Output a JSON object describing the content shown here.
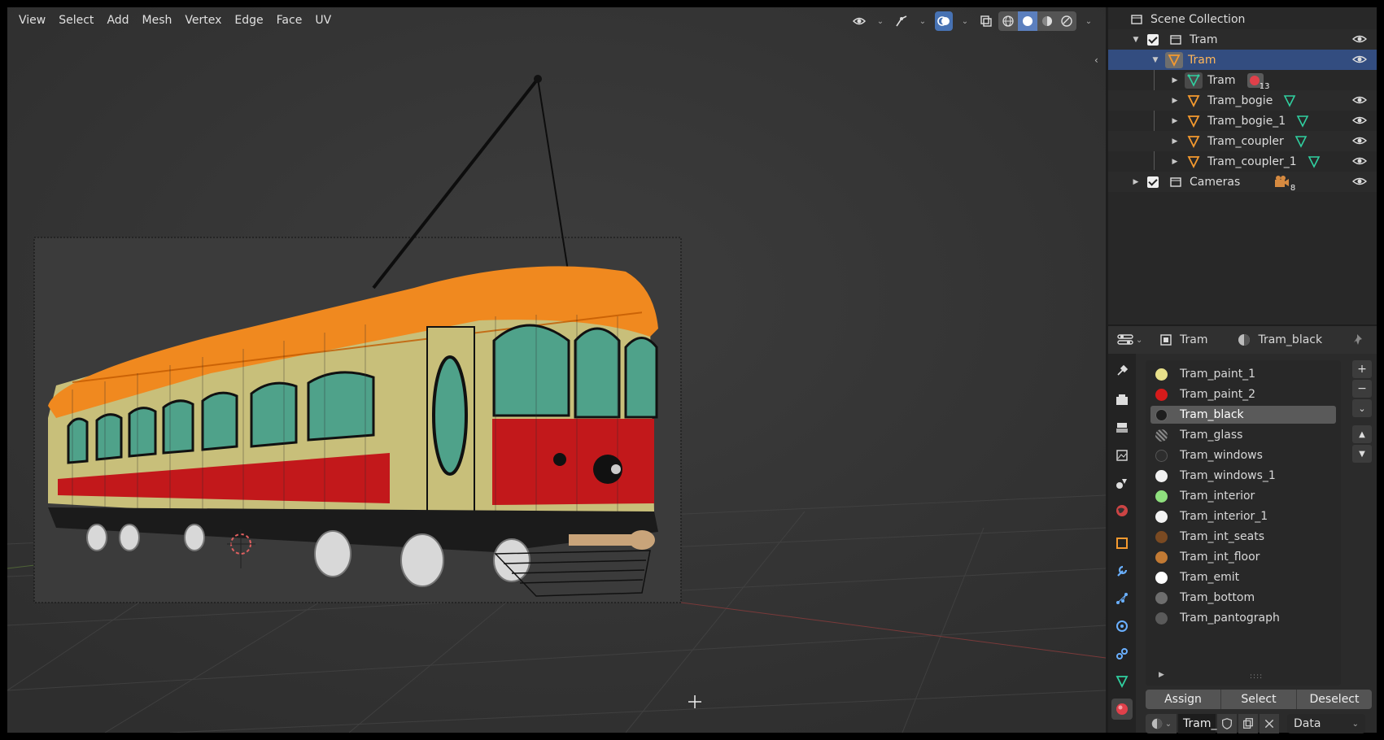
{
  "viewport": {
    "menu": [
      "View",
      "Select",
      "Add",
      "Mesh",
      "Vertex",
      "Edge",
      "Face",
      "UV"
    ]
  },
  "outliner": {
    "rows": [
      {
        "label": "Scene Collection",
        "icon": "scene-collection-icon"
      },
      {
        "label": "Tram",
        "icon": "collection-icon"
      },
      {
        "label": "Tram",
        "icon": "mesh-object-icon"
      },
      {
        "label": "Tram",
        "icon": "mesh-data-icon",
        "badge": "13",
        "badge_icon": "material-icon"
      },
      {
        "label": "Tram_bogie",
        "icon": "mesh-object-icon"
      },
      {
        "label": "Tram_bogie_1",
        "icon": "mesh-object-icon"
      },
      {
        "label": "Tram_coupler",
        "icon": "mesh-object-icon"
      },
      {
        "label": "Tram_coupler_1",
        "icon": "mesh-object-icon"
      },
      {
        "label": "Cameras",
        "icon": "collection-icon",
        "badge": "8",
        "badge_icon": "camera-icon"
      }
    ]
  },
  "properties": {
    "object_name": "Tram",
    "material_name": "Tram_black",
    "materials": [
      {
        "name": "Tram_paint_1",
        "color": "#e8e08a"
      },
      {
        "name": "Tram_paint_2",
        "color": "#d61b1b"
      },
      {
        "name": "Tram_black",
        "color": "#1e1e1e"
      },
      {
        "name": "Tram_glass",
        "color": "#7a7a7a"
      },
      {
        "name": "Tram_windows",
        "color": "#2d2d2d"
      },
      {
        "name": "Tram_windows_1",
        "color": "#f2f2f2"
      },
      {
        "name": "Tram_interior",
        "color": "#8fe07e"
      },
      {
        "name": "Tram_interior_1",
        "color": "#f4f4f4"
      },
      {
        "name": "Tram_int_seats",
        "color": "#7a4a22"
      },
      {
        "name": "Tram_int_floor",
        "color": "#c27a34"
      },
      {
        "name": "Tram_emit",
        "color": "#ffffff"
      },
      {
        "name": "Tram_bottom",
        "color": "#6e6e6e"
      },
      {
        "name": "Tram_pantograph",
        "color": "#5a5a5a"
      }
    ],
    "buttons": {
      "assign": "Assign",
      "select": "Select",
      "deselect": "Deselect"
    },
    "slot_name": "Tram_",
    "link_mode": "Data"
  },
  "colors": {
    "accent": "#4772b3",
    "selected_row": "#334d80",
    "active_text": "#ffb75a"
  }
}
